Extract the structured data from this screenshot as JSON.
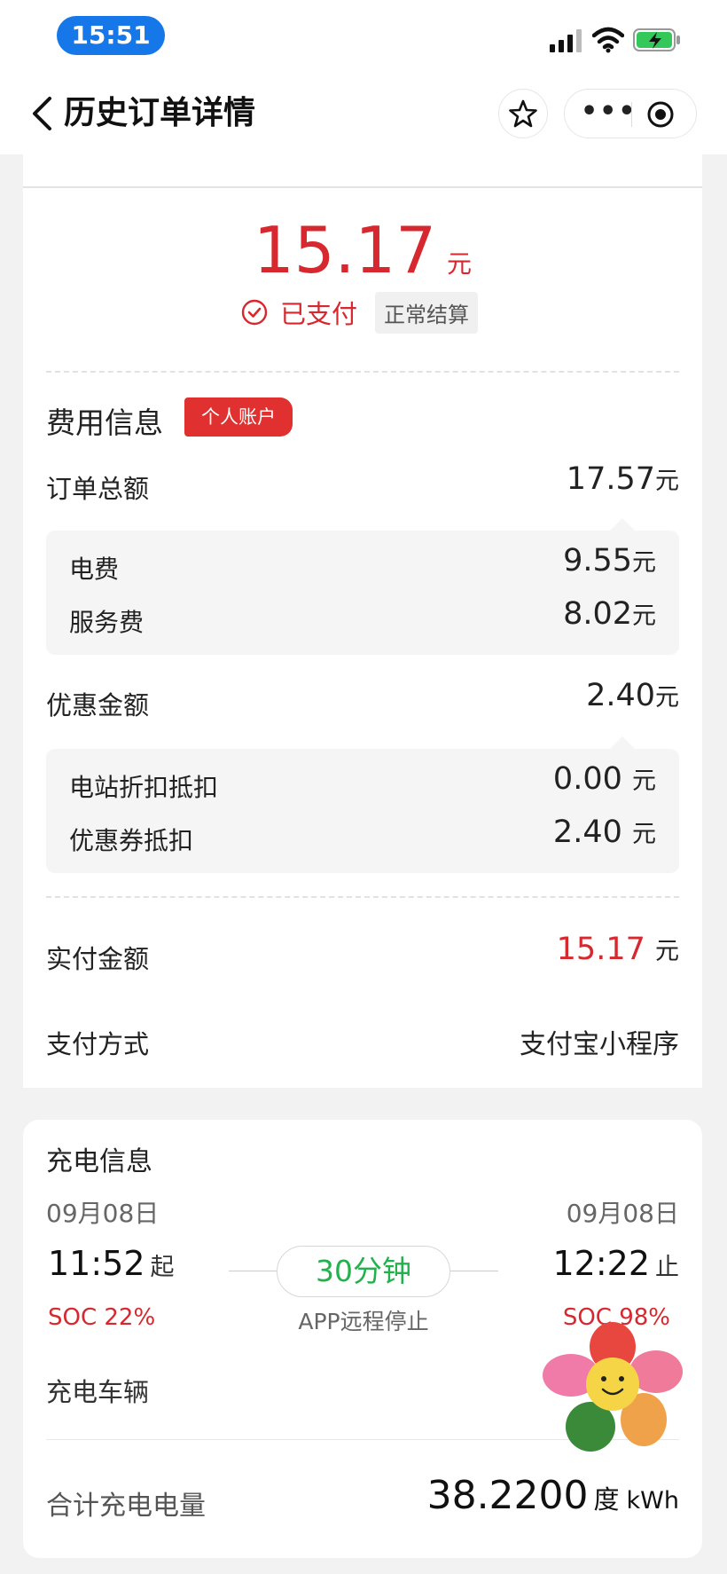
{
  "status_bar": {
    "time": "15:51"
  },
  "nav": {
    "title": "历史订单详情"
  },
  "summary": {
    "amount": "15.17",
    "unit": "元",
    "paid_status": "已支付",
    "settle_tag": "正常结算"
  },
  "fees": {
    "section_title": "费用信息",
    "account_badge": "个人账户",
    "order_total_label": "订单总额",
    "order_total_value": "17.57",
    "order_total_unit": "元",
    "breakdown": [
      {
        "label": "电费",
        "value": "9.55",
        "unit": "元"
      },
      {
        "label": "服务费",
        "value": "8.02",
        "unit": "元"
      }
    ],
    "discount_label": "优惠金额",
    "discount_value": "2.40",
    "discount_unit": "元",
    "discount_breakdown": [
      {
        "label": "电站折扣抵扣",
        "value": "0.00",
        "unit": "元"
      },
      {
        "label": "优惠券抵扣",
        "value": "2.40",
        "unit": "元"
      }
    ],
    "paid_label": "实付金额",
    "paid_value": "15.17",
    "paid_unit": "元",
    "method_label": "支付方式",
    "method_value": "支付宝小程序"
  },
  "charging": {
    "section_title": "充电信息",
    "start_date": "09月08日",
    "end_date": "09月08日",
    "start_time": "11:52",
    "start_suffix": "起",
    "end_time": "12:22",
    "end_suffix": "止",
    "start_soc": "SOC 22%",
    "end_soc": "SOC 98%",
    "duration": "30分钟",
    "stop_reason": "APP远程停止",
    "vehicle_label": "充电车辆",
    "total_label": "合计充电电量",
    "total_value": "38.2200",
    "total_unit1": "度",
    "total_unit2": "kWh"
  }
}
